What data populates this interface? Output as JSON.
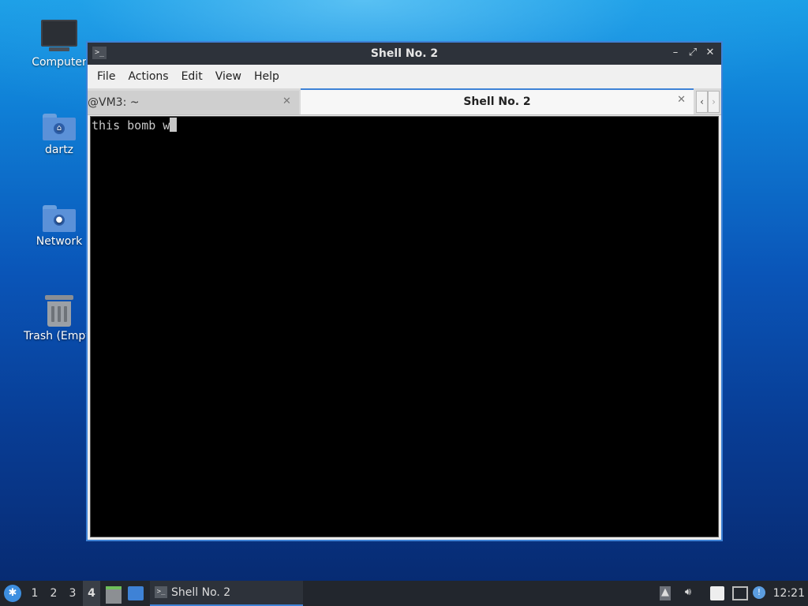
{
  "desktop": {
    "icons": [
      {
        "label": "Computer",
        "icon": "computer-icon"
      },
      {
        "label": "dartz",
        "icon": "home-folder-icon"
      },
      {
        "label": "Network",
        "icon": "network-folder-icon"
      },
      {
        "label": "Trash (Empty)",
        "icon": "trash-icon"
      }
    ]
  },
  "window": {
    "title": "Shell No. 2",
    "menu": [
      "File",
      "Actions",
      "Edit",
      "View",
      "Help"
    ],
    "tabs": [
      {
        "label": "@VM3: ~",
        "active": false
      },
      {
        "label": "Shell No. 2",
        "active": true
      }
    ],
    "terminal": {
      "text": "this bomb w"
    }
  },
  "taskbar": {
    "workspaces": [
      "1",
      "2",
      "3",
      "4"
    ],
    "active_workspace": "4",
    "task_label": "Shell No. 2",
    "clock": "12:21"
  },
  "colors": {
    "accent": "#3e82d6",
    "titlebar": "#2d323a",
    "taskbar": "#22262d"
  }
}
